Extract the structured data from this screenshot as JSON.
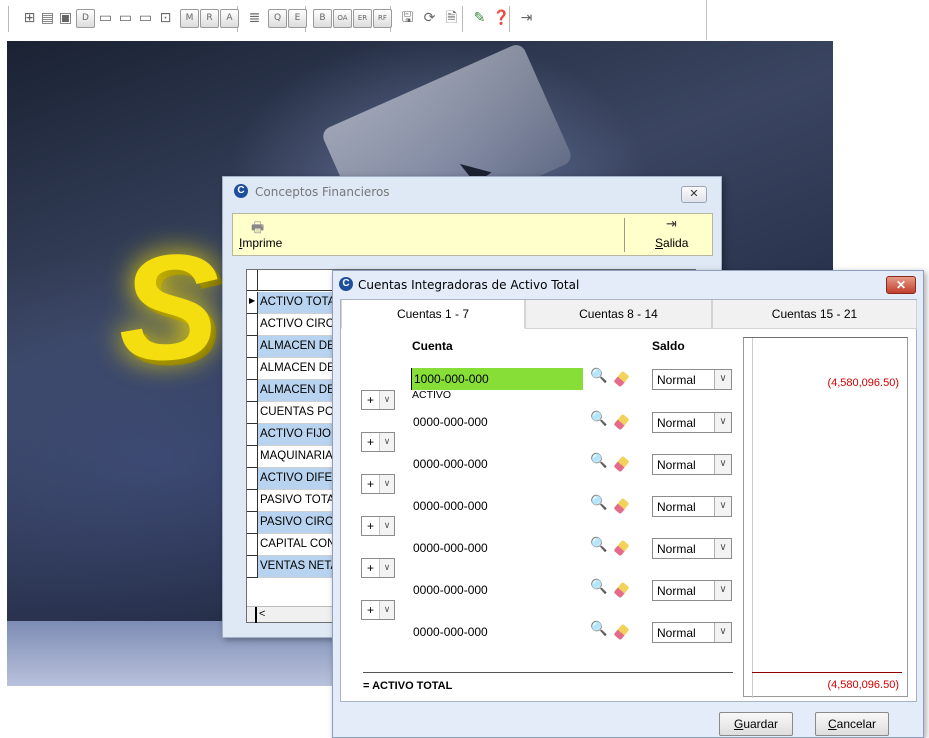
{
  "toolbar": {
    "buttons": [
      {
        "name": "structure-icon",
        "glyph": "⊞"
      },
      {
        "name": "table-icon",
        "glyph": "▤"
      },
      {
        "name": "database-icon",
        "glyph": "▣"
      },
      {
        "name": "d-button",
        "glyph": "D"
      },
      {
        "name": "window-icon-1",
        "glyph": "▭"
      },
      {
        "name": "window-icon-2",
        "glyph": "▭"
      },
      {
        "name": "window-icon-3",
        "glyph": "▭"
      },
      {
        "name": "grid-icon",
        "glyph": "⊡"
      },
      {
        "name": "m-button",
        "glyph": "M"
      },
      {
        "name": "r-button",
        "glyph": "R"
      },
      {
        "name": "a-button",
        "glyph": "A"
      },
      {
        "name": "list-icon",
        "glyph": "≣"
      },
      {
        "name": "q-button",
        "glyph": "Q"
      },
      {
        "name": "e-button",
        "glyph": "E"
      },
      {
        "name": "b-button",
        "glyph": "B"
      },
      {
        "name": "oa-button",
        "glyph": "OA"
      },
      {
        "name": "er-button",
        "glyph": "ER"
      },
      {
        "name": "rf-button",
        "glyph": "RF"
      },
      {
        "name": "save-icon",
        "glyph": "🖫"
      },
      {
        "name": "refresh-icon",
        "glyph": "⟳"
      },
      {
        "name": "report-icon",
        "glyph": "🗎"
      },
      {
        "name": "edit-icon",
        "glyph": "✎"
      },
      {
        "name": "help-icon",
        "glyph": "❓"
      },
      {
        "name": "exit-icon",
        "glyph": "⇥"
      }
    ]
  },
  "conceptos": {
    "title": "Conceptos Financieros",
    "close_glyph": "✕",
    "print_label": "Imprime",
    "print_access_key": "I",
    "exit_label": "Salida",
    "exit_access_key": "S",
    "rows": [
      "ACTIVO TOTAL",
      "ACTIVO CIRCULANTE",
      "ALMACEN DE",
      "ALMACEN DE",
      "ALMACEN DE",
      "CUENTAS POR",
      "ACTIVO FIJO",
      "MAQUINARIA",
      "ACTIVO DIFERIDO",
      "PASIVO TOTAL",
      "PASIVO CIRCULANTE",
      "CAPITAL CONTABLE",
      "VENTAS NETAS"
    ],
    "scroll_arrow": "<"
  },
  "cuentas": {
    "title": "Cuentas Integradoras de Activo Total",
    "close_glyph": "✕",
    "tabs": [
      "Cuentas 1 - 7",
      "Cuentas 8 - 14",
      "Cuentas 15 - 21"
    ],
    "col_cuenta": "Cuenta",
    "col_saldo": "Saldo",
    "rows": [
      {
        "code": "1000-000-000",
        "desc": "ACTIVO",
        "saldo": "Normal",
        "amount": "(4,580,096.50)"
      },
      {
        "code": "0000-000-000",
        "desc": "",
        "saldo": "Normal",
        "op": "+"
      },
      {
        "code": "0000-000-000",
        "desc": "",
        "saldo": "Normal",
        "op": "+"
      },
      {
        "code": "0000-000-000",
        "desc": "",
        "saldo": "Normal",
        "op": "+"
      },
      {
        "code": "0000-000-000",
        "desc": "",
        "saldo": "Normal",
        "op": "+"
      },
      {
        "code": "0000-000-000",
        "desc": "",
        "saldo": "Normal",
        "op": "+"
      },
      {
        "code": "0000-000-000",
        "desc": "",
        "saldo": "Normal",
        "op": "+"
      }
    ],
    "total_label": "=  ACTIVO TOTAL",
    "total_amount": "(4,580,096.50)",
    "save_label": "Guardar",
    "cancel_label": "Cancelar",
    "dropdown_glyph": "∨"
  }
}
